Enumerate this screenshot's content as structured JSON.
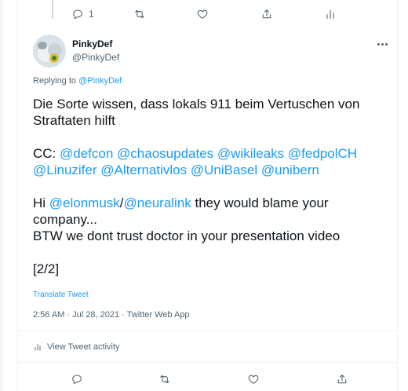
{
  "top_actions": {
    "reply_count": "1"
  },
  "tweet": {
    "display_name": "PinkyDef",
    "handle": "@PinkyDef",
    "replying_label": "Replying to",
    "replying_to": "@PinkyDef",
    "lines": [
      [
        {
          "t": "Die Sorte wissen, dass lokals 911 beim Vertuschen von",
          "link": false
        }
      ],
      [
        {
          "t": "Straftaten hilft",
          "link": false
        }
      ],
      [],
      [
        {
          "t": "CC: ",
          "link": false
        },
        {
          "t": "@defcon",
          "link": true
        },
        {
          "t": " ",
          "link": false
        },
        {
          "t": "@chaosupdates",
          "link": true
        },
        {
          "t": " ",
          "link": false
        },
        {
          "t": "@wikileaks",
          "link": true
        },
        {
          "t": " ",
          "link": false
        },
        {
          "t": "@fedpolCH",
          "link": true
        }
      ],
      [
        {
          "t": "@Linuzifer",
          "link": true
        },
        {
          "t": " ",
          "link": false
        },
        {
          "t": "@Alternativlos",
          "link": true
        },
        {
          "t": " ",
          "link": false
        },
        {
          "t": "@UniBasel",
          "link": true
        },
        {
          "t": " ",
          "link": false
        },
        {
          "t": "@unibern",
          "link": true
        }
      ],
      [],
      [
        {
          "t": "Hi ",
          "link": false
        },
        {
          "t": "@elonmusk",
          "link": true
        },
        {
          "t": "/",
          "link": false
        },
        {
          "t": "@neuralink",
          "link": true
        },
        {
          "t": " they would blame your",
          "link": false
        }
      ],
      [
        {
          "t": "company...",
          "link": false
        }
      ],
      [
        {
          "t": "BTW we dont trust doctor in your presentation video",
          "link": false
        }
      ],
      [],
      [
        {
          "t": "[2/2]",
          "link": false
        }
      ]
    ],
    "translate_label": "Translate Tweet",
    "timestamp": "2:56 AM · Jul 28, 2021 · Twitter Web App",
    "activity_label": "View Tweet activity"
  },
  "colors": {
    "accent": "#1d9bf0",
    "muted": "#536471",
    "text": "#0f1419",
    "divider": "#eff3f4"
  }
}
